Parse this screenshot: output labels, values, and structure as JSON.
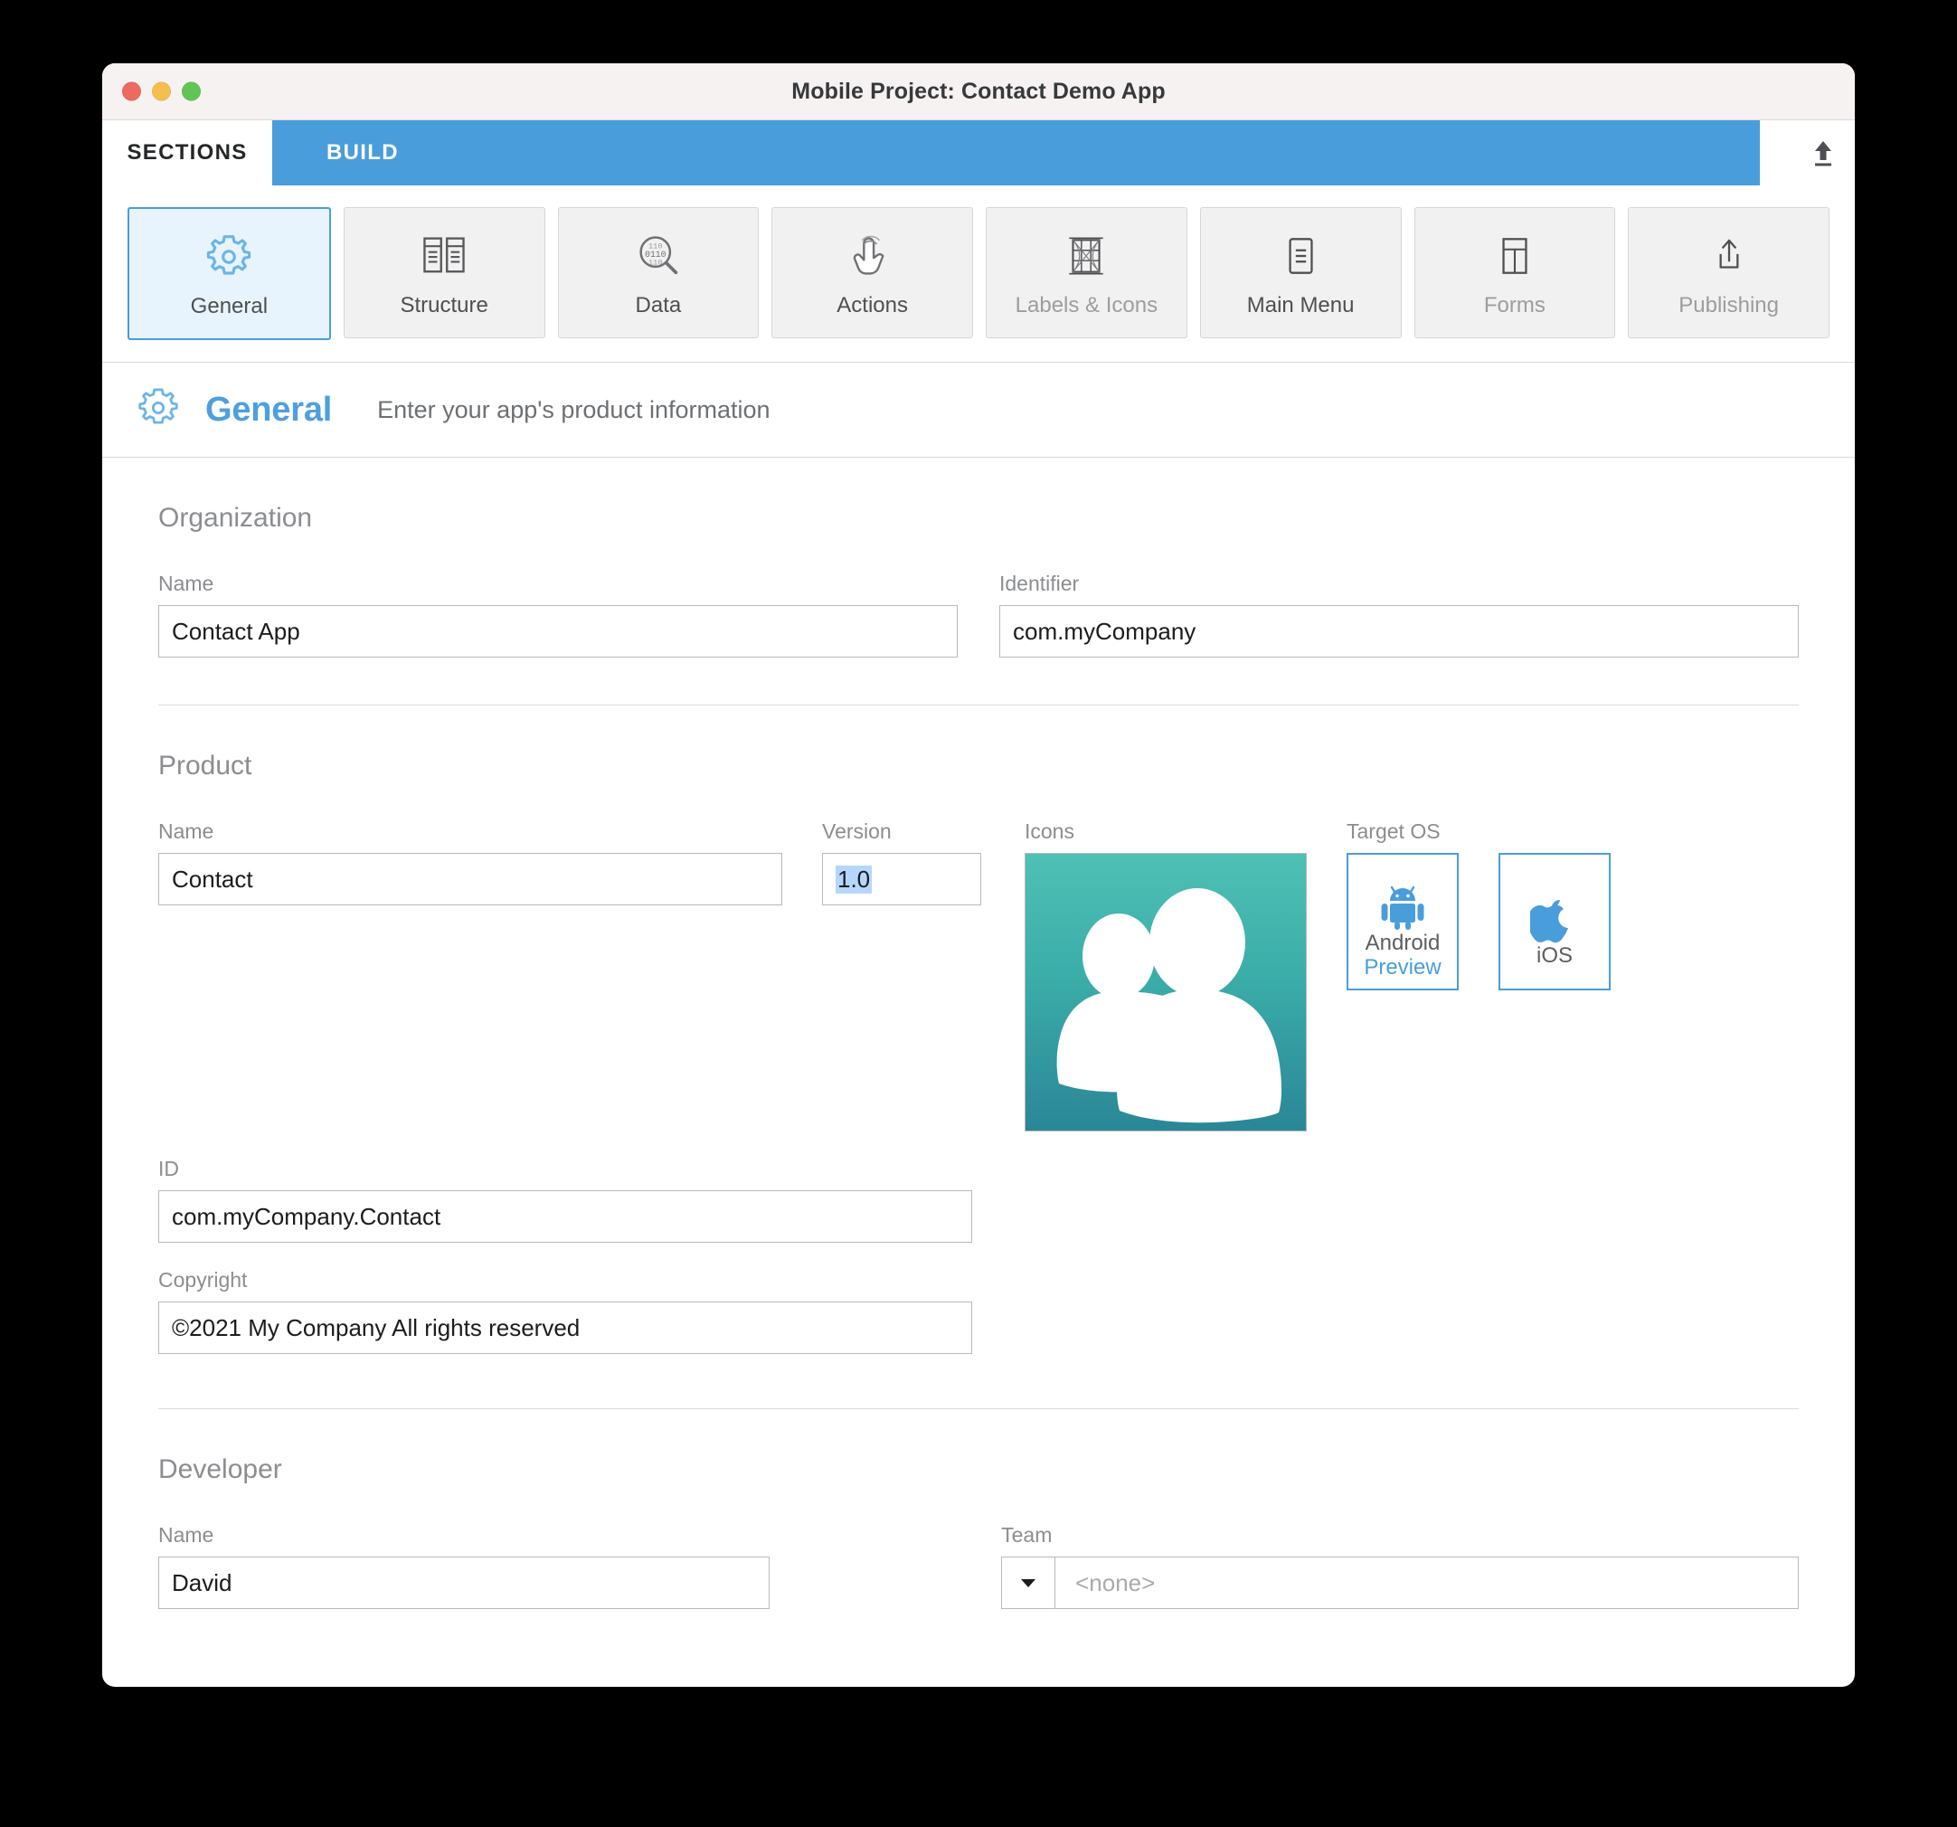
{
  "window": {
    "title": "Mobile Project: Contact Demo App",
    "traffic_lights": [
      "close",
      "minimize",
      "maximize"
    ]
  },
  "tabs": [
    {
      "label": "SECTIONS",
      "active": true
    },
    {
      "label": "BUILD",
      "active": false
    }
  ],
  "toolbar": {
    "upload_icon": "upload-icon",
    "buttons": [
      {
        "label": "General",
        "icon": "gear-icon",
        "active": true,
        "dim": false
      },
      {
        "label": "Structure",
        "icon": "structure-icon",
        "active": false,
        "dim": false
      },
      {
        "label": "Data",
        "icon": "data-search-icon",
        "active": false,
        "dim": false
      },
      {
        "label": "Actions",
        "icon": "tap-hand-icon",
        "active": false,
        "dim": false
      },
      {
        "label": "Labels & Icons",
        "icon": "labels-icon",
        "active": false,
        "dim": true
      },
      {
        "label": "Main Menu",
        "icon": "menu-doc-icon",
        "active": false,
        "dim": false
      },
      {
        "label": "Forms",
        "icon": "forms-icon",
        "active": false,
        "dim": true
      },
      {
        "label": "Publishing",
        "icon": "publish-icon",
        "active": false,
        "dim": true
      }
    ]
  },
  "page": {
    "icon": "gear-icon",
    "title": "General",
    "subtitle": "Enter your app's product information"
  },
  "organization": {
    "group_title": "Organization",
    "name_label": "Name",
    "name_value": "Contact App",
    "identifier_label": "Identifier",
    "identifier_value": "com.myCompany"
  },
  "product": {
    "group_title": "Product",
    "name_label": "Name",
    "name_value": "Contact",
    "version_label": "Version",
    "version_value": "1.0",
    "id_label": "ID",
    "id_value": "com.myCompany.Contact",
    "copyright_label": "Copyright",
    "copyright_value": "©2021 My Company All rights reserved",
    "icons_label": "Icons",
    "icon_image": "contacts-people-app-icon",
    "target_os_label": "Target OS",
    "os_options": [
      {
        "name": "Android",
        "icon": "android-icon",
        "sublabel": "Preview",
        "selected": true
      },
      {
        "name": "iOS",
        "icon": "apple-icon",
        "sublabel": "",
        "selected": true
      }
    ]
  },
  "developer": {
    "group_title": "Developer",
    "name_label": "Name",
    "name_value": "David",
    "team_label": "Team",
    "team_placeholder": "<none>",
    "team_value": ""
  },
  "colors": {
    "accent_blue": "#4a9ddb",
    "tab_build_bg": "#4a9ddb",
    "selection_blue": "#b6d7fb",
    "title_bar_bg": "#f6f2f2",
    "section_btn_bg": "#f1f1f1",
    "active_btn_bg": "#e8f4fd",
    "icon_gradient_top": "#4ec0b4",
    "icon_gradient_bottom": "#2a8697",
    "label_gray": "#8b8d90"
  }
}
